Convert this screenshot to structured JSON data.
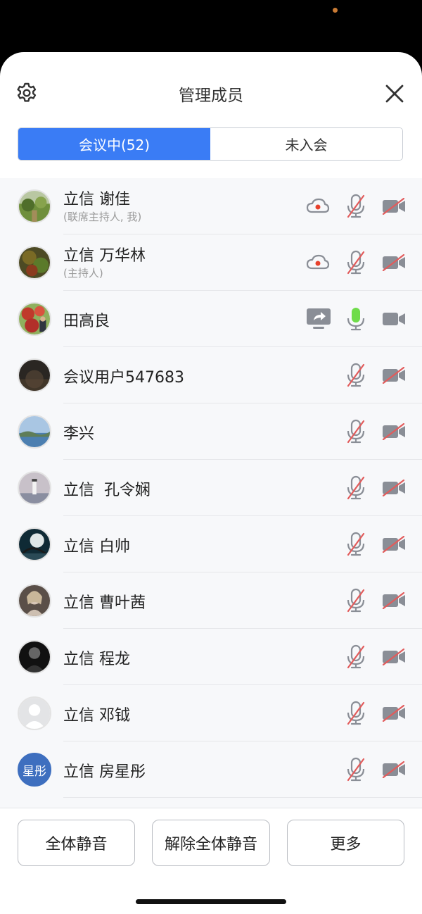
{
  "header": {
    "title": "管理成员",
    "settings_icon": "gear-icon",
    "close_icon": "close-icon"
  },
  "tabs": [
    {
      "label": "会议中(52)",
      "active": true
    },
    {
      "label": "未入会",
      "active": false
    }
  ],
  "members": [
    {
      "name": "立信 谢佳",
      "role": "(联席主持人, 我)",
      "avatar": "photo-garden",
      "status_icon": "cloud-record-icon",
      "mic": "muted",
      "camera": "off"
    },
    {
      "name": "立信 万华林",
      "role": "(主持人)",
      "avatar": "photo-foliage",
      "status_icon": "cloud-record-icon",
      "mic": "muted",
      "camera": "off"
    },
    {
      "name": "田高良",
      "role": "",
      "avatar": "photo-red-flowers",
      "status_icon": "screen-share-icon",
      "mic": "active",
      "camera": "on"
    },
    {
      "name": "会议用户547683",
      "role": "",
      "avatar": "photo-night-sky",
      "status_icon": "",
      "mic": "muted",
      "camera": "off"
    },
    {
      "name": "李兴",
      "role": "",
      "avatar": "photo-coast",
      "status_icon": "",
      "mic": "muted",
      "camera": "off"
    },
    {
      "name": "立信  孔令娴",
      "role": "",
      "avatar": "photo-lighthouse",
      "status_icon": "",
      "mic": "muted",
      "camera": "off"
    },
    {
      "name": "立信 白帅",
      "role": "",
      "avatar": "photo-moon-tree",
      "status_icon": "",
      "mic": "muted",
      "camera": "off"
    },
    {
      "name": "立信 曹叶茜",
      "role": "",
      "avatar": "photo-portrait",
      "status_icon": "",
      "mic": "muted",
      "camera": "off"
    },
    {
      "name": "立信 程龙",
      "role": "",
      "avatar": "photo-dark-portrait",
      "status_icon": "",
      "mic": "muted",
      "camera": "off"
    },
    {
      "name": "立信 邓钺",
      "role": "",
      "avatar": "default-person",
      "status_icon": "",
      "mic": "muted",
      "camera": "off"
    },
    {
      "name": "立信 房星彤",
      "role": "",
      "avatar_text": "星彤",
      "avatar": "text-badge",
      "status_icon": "",
      "mic": "muted",
      "camera": "off"
    }
  ],
  "footer": {
    "mute_all": "全体静音",
    "unmute_all": "解除全体静音",
    "more": "更多"
  },
  "colors": {
    "accent": "#3a7cf5",
    "record_dot": "#e8412c",
    "muted_slash": "#e25b5b",
    "mic_active": "#6fdc4a",
    "icon_gray": "#8a8e96"
  }
}
